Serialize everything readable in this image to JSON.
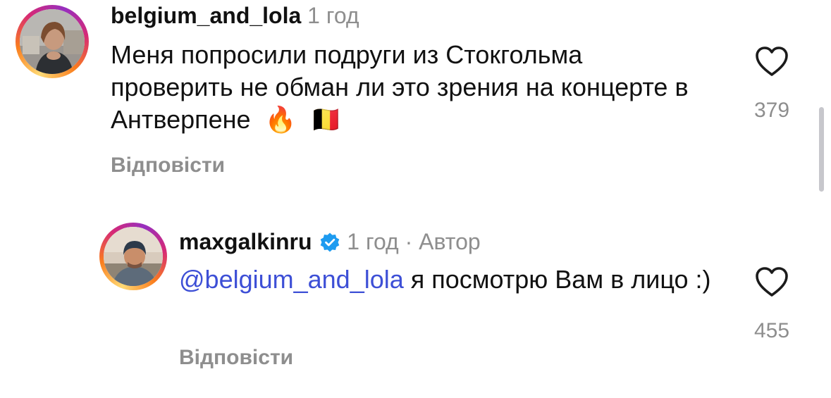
{
  "comments": [
    {
      "username": "belgium_and_lola",
      "time": "1 год",
      "text": "Меня попросили подруги из Стокгольма проверить не обман ли это зрения на концерте в Антверпене",
      "emojis": [
        "🔥",
        "🇧🇪"
      ],
      "reply_label": "Відповісти",
      "likes": "379",
      "avatar_icon": "profile-photo-woman"
    },
    {
      "username": "maxgalkinru",
      "verified": true,
      "time": "1 год",
      "separator": "·",
      "author_badge": "Автор",
      "mention": "@belgium_and_lola",
      "text": "я посмотрю Вам в лицо :)",
      "reply_label": "Відповісти",
      "likes": "455",
      "avatar_icon": "profile-photo-man"
    }
  ],
  "colors": {
    "mention": "#3d4fd6",
    "verified": "#1d9bf0",
    "muted": "#8e8e8e"
  }
}
